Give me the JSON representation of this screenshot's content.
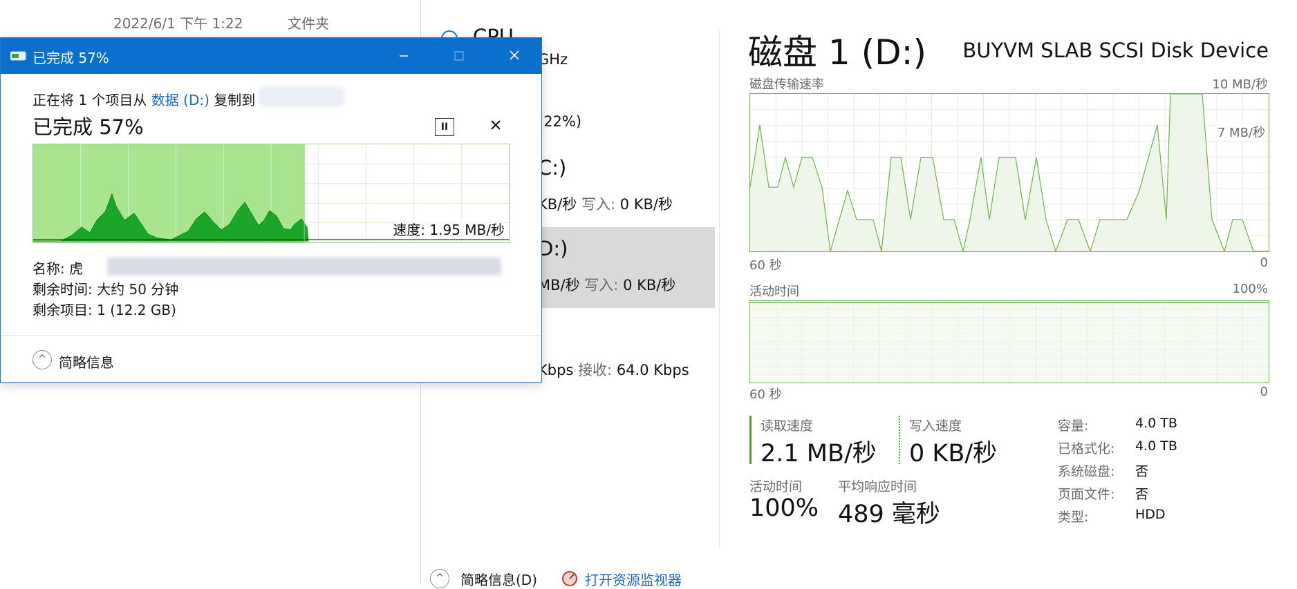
{
  "explorer_row": {
    "date": "2022/6/1 下午 1:22",
    "type": "文件夹"
  },
  "task_manager": {
    "sidebar": {
      "cpu_label": "CPU",
      "cpu_freq": "GHz",
      "mem_pct": "(22%)",
      "disk0_name": "C:)",
      "disk0_rate": "KB/秒",
      "disk0_write_label": "写入:",
      "disk0_write_val": "0 KB/秒",
      "disk1_name": "D:)",
      "disk1_rate": "MB/秒",
      "disk1_write_label": "写入:",
      "disk1_write_val": "0 KB/秒",
      "net_send": "Kbps",
      "net_recv_label": "接收:",
      "net_recv_val": "64.0 Kbps"
    },
    "title": "磁盘 1 (D:)",
    "model": "BUYVM SLAB SCSI Disk Device",
    "graph1": {
      "label": "磁盘传输速率",
      "max": "10 MB/秒",
      "mid": "7 MB/秒",
      "xleft": "60 秒",
      "xright": "0"
    },
    "graph2": {
      "label": "活动时间",
      "max": "100%",
      "xleft": "60 秒",
      "xright": "0"
    },
    "stats": {
      "read_label": "读取速度",
      "read_val": "2.1 MB/秒",
      "write_label": "写入速度",
      "write_val": "0 KB/秒",
      "active_label": "活动时间",
      "active_val": "100%",
      "resp_label": "平均响应时间",
      "resp_val": "489 毫秒"
    },
    "props": [
      {
        "k": "容量:",
        "v": "4.0 TB"
      },
      {
        "k": "已格式化:",
        "v": "4.0 TB"
      },
      {
        "k": "系统磁盘:",
        "v": "否"
      },
      {
        "k": "页面文件:",
        "v": "否"
      },
      {
        "k": "类型:",
        "v": "HDD"
      }
    ],
    "bottom": {
      "fewer": "简略信息(D)",
      "monitor": "打开资源监视器"
    },
    "colors": {
      "graph_line": "#6cb34a",
      "graph_fill": "#eef6ea",
      "grid": "#e3eee0"
    }
  },
  "dialog": {
    "title": "已完成 57%",
    "line_prefix": "正在将 1 个项目从",
    "source": "数据 (D:)",
    "line_mid": "复制到",
    "percent_text": "已完成 57%",
    "progress": 0.57,
    "speed": "速度: 1.95 MB/秒",
    "name_label": "名称:",
    "name_value": "虎",
    "remaining_time_label": "剩余时间:",
    "remaining_time_value": "大约 50 分钟",
    "remaining_items_label": "剩余项目:",
    "remaining_items_value": "1 (12.2 GB)",
    "fewer_details": "简略信息",
    "minimize_icon": "minimize-icon",
    "maximize_icon": "maximize-icon",
    "close_icon": "close-icon"
  }
}
